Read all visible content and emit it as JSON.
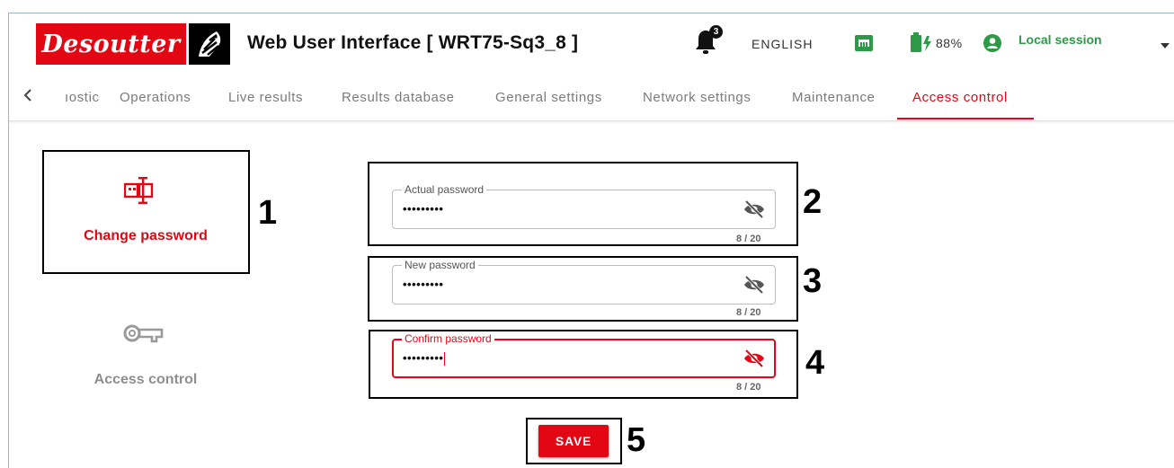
{
  "header": {
    "brand": "Desoutter",
    "title": "Web User Interface [ WRT75-Sq3_8 ]",
    "notifications_count": "3",
    "language": "ENGLISH",
    "battery": "88%",
    "session": "Local session"
  },
  "tabs": {
    "items": [
      {
        "label": "ıostic"
      },
      {
        "label": "Operations"
      },
      {
        "label": "Live results"
      },
      {
        "label": "Results database"
      },
      {
        "label": "General settings"
      },
      {
        "label": "Network settings"
      },
      {
        "label": "Maintenance"
      },
      {
        "label": "Access control"
      }
    ],
    "active": "Access control"
  },
  "sidebar": {
    "items": [
      {
        "label": "Change password",
        "icon": "password-icon",
        "active": true
      },
      {
        "label": "Access control",
        "icon": "key-icon",
        "active": false
      }
    ]
  },
  "form": {
    "fields": [
      {
        "label": "Actual password",
        "value": "•••••••••",
        "counter": "8 / 20"
      },
      {
        "label": "New password",
        "value": "•••••••••",
        "counter": "8 / 20"
      },
      {
        "label": "Confirm password",
        "value": "•••••••••",
        "counter": "8 / 20",
        "focused": true
      }
    ],
    "save_label": "SAVE"
  },
  "callouts": [
    "1",
    "2",
    "3",
    "4",
    "5"
  ],
  "colors": {
    "accent": "#e30613",
    "session_green": "#2e9a48",
    "inactive_tab": "#7b7b7b"
  }
}
